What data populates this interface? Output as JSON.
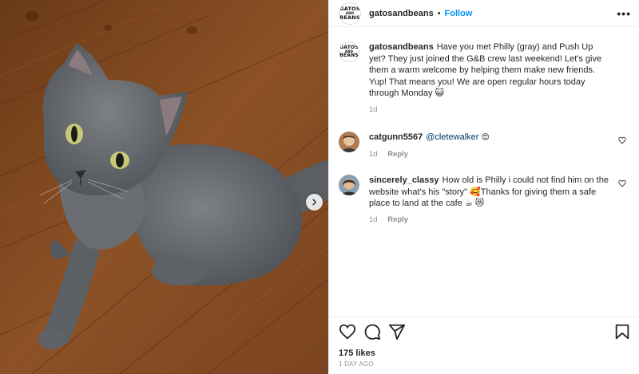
{
  "header": {
    "logo_lines": [
      "GATOS",
      "AND",
      "BEANS"
    ],
    "username": "gatosandbeans",
    "separator": "•",
    "follow_label": "Follow",
    "more_label": "•••"
  },
  "caption": {
    "username": "gatosandbeans",
    "text": "Have you met Philly (gray) and Push Up yet? They just joined the G&B crew last weekend! Let's give them a warm welcome by helping them make new friends. Yup! That means you! We are open regular hours today through Monday 😺",
    "time": "1d"
  },
  "comments": [
    {
      "username": "catgunn5567",
      "mention": "@cletewalker",
      "text": "😍",
      "time": "1d",
      "reply_label": "Reply"
    },
    {
      "username": "sincerely_classy",
      "text": "How old is Philly i could not find him on the website what's his \"story\" 🥰Thanks for giving them a safe place to land at the cafe ☕ 😻",
      "time": "1d",
      "reply_label": "Reply"
    }
  ],
  "actions": {
    "icons": [
      "heart-icon",
      "comment-icon",
      "share-icon",
      "bookmark-icon"
    ]
  },
  "likes": "175 likes",
  "posted": "1 DAY AGO",
  "colors": {
    "accent": "#0095f6",
    "mention": "#00376b",
    "muted": "#8e8e8e",
    "floor": "#8a4d22",
    "cat": "#6b6f73"
  }
}
